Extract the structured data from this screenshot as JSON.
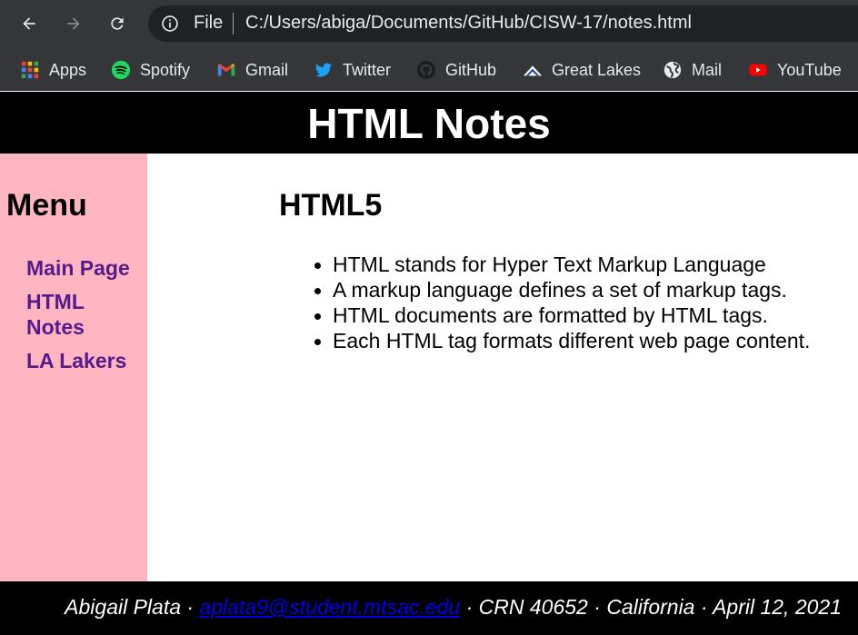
{
  "browser": {
    "file_label": "File",
    "url": "C:/Users/abiga/Documents/GitHub/CISW-17/notes.html",
    "bookmarks": [
      {
        "label": "Apps",
        "icon": "apps-grid-icon"
      },
      {
        "label": "Spotify",
        "icon": "spotify-icon"
      },
      {
        "label": "Gmail",
        "icon": "gmail-icon"
      },
      {
        "label": "Twitter",
        "icon": "twitter-icon"
      },
      {
        "label": "GitHub",
        "icon": "github-icon"
      },
      {
        "label": "Great Lakes",
        "icon": "great-lakes-icon"
      },
      {
        "label": "Mail",
        "icon": "globe-icon"
      },
      {
        "label": "YouTube",
        "icon": "youtube-icon"
      }
    ]
  },
  "page": {
    "title": "HTML Notes",
    "menu": {
      "heading": "Menu",
      "links": [
        "Main Page",
        "HTML Notes",
        "LA Lakers"
      ]
    },
    "section": {
      "heading": "HTML5",
      "items": [
        "HTML stands for Hyper Text Markup Language",
        "A markup language defines a set of markup tags.",
        "HTML documents are formatted by HTML tags.",
        "Each HTML tag formats different web page content."
      ]
    },
    "footer": {
      "name": "Abigail Plata",
      "separator": " · ",
      "email": "aplata9@student.mtsac.edu",
      "crn": "CRN 40652",
      "location": "California",
      "date": "April 12, 2021"
    }
  },
  "colors": {
    "chrome": "#35363a",
    "omnibox": "#202124",
    "header_bg": "#000000",
    "sidebar_bg": "#ffb6c1",
    "link": "#551a8b",
    "footer_link": "#0000ee"
  }
}
